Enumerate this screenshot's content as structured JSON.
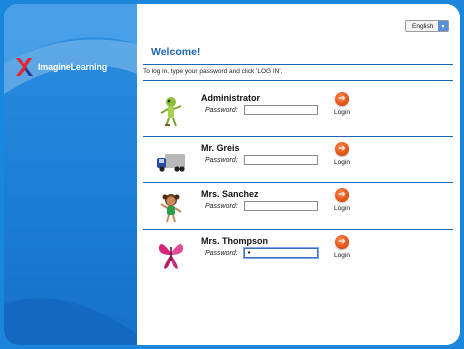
{
  "app": {
    "logo_text": "ImagineLearning",
    "language": "English"
  },
  "main": {
    "welcome": "Welcome!",
    "instructions": "To log in, type your password and click 'LOG IN'."
  },
  "users": [
    {
      "name": "Administrator",
      "password_label": "Password:",
      "password_value": "",
      "login_label": "Login",
      "avatar": "grasshopper-icon"
    },
    {
      "name": "Mr. Greis",
      "password_label": "Password:",
      "password_value": "",
      "login_label": "Login",
      "avatar": "truck-icon"
    },
    {
      "name": "Mrs. Sanchez",
      "password_label": "Password:",
      "password_value": "",
      "login_label": "Login",
      "avatar": "girl-icon"
    },
    {
      "name": "Mrs. Thompson",
      "password_label": "Password:",
      "password_value": "•",
      "login_label": "Login",
      "avatar": "butterfly-icon"
    }
  ],
  "colors": {
    "brand_blue": "#1a87dc",
    "heading_blue": "#1f66b3",
    "login_orange": "#e04a10"
  }
}
